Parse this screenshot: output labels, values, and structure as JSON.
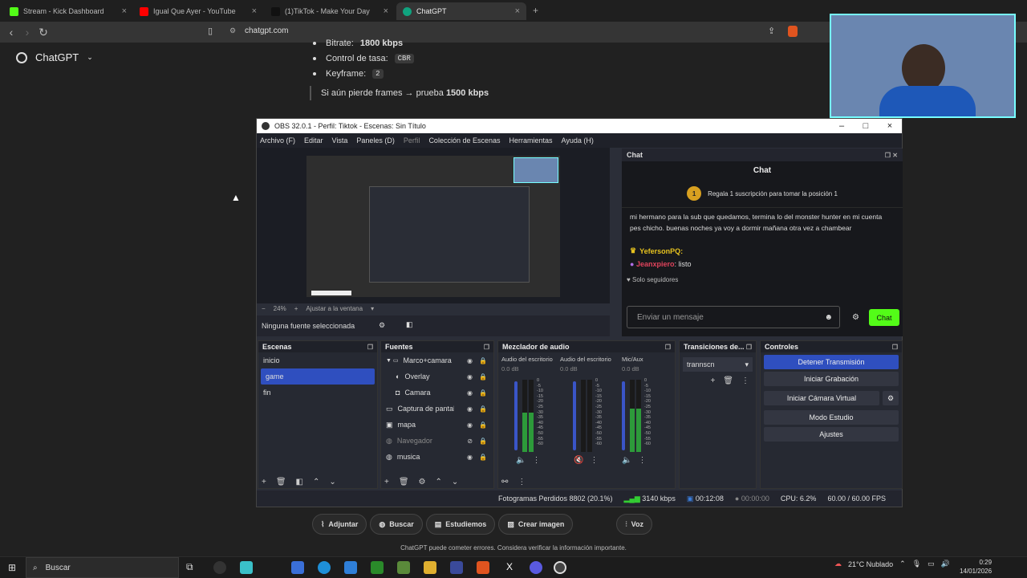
{
  "browser": {
    "tabs": [
      {
        "label": "Stream - Kick Dashboard",
        "color": "#53fc18"
      },
      {
        "label": "Igual Que Ayer - YouTube",
        "color": "#ff0000"
      },
      {
        "label": "(1)TikTok - Make Your Day",
        "color": "#111111"
      },
      {
        "label": "ChatGPT",
        "color": "#10a37f"
      }
    ],
    "url": "chatgpt.com"
  },
  "chatgpt": {
    "logo_label": "ChatGPT",
    "bullets": [
      {
        "label": "Bitrate:",
        "value": "1800 kbps"
      },
      {
        "label": "Control de tasa:",
        "value": "CBR"
      },
      {
        "label": "Keyframe:",
        "value": "2"
      }
    ],
    "quote_prefix": "Si aún pierde frames → prueba",
    "quote_value": "1500 kbps",
    "buttons": [
      "Adjuntar",
      "Buscar",
      "Estudiemos",
      "Crear imagen"
    ],
    "voice": "Voz",
    "disclaimer": "ChatGPT puede cometer errores. Considera verificar la información importante."
  },
  "obs": {
    "title": "OBS 32.0.1 - Perfil: Tiktok - Escenas: Sin Título",
    "menu": [
      "Archivo (F)",
      "Editar",
      "Vista",
      "Paneles (D)",
      "Perfil",
      "Colección de Escenas",
      "Herramientas",
      "Ayuda (H)"
    ],
    "zoom": "24%",
    "fit": "Ajustar a la ventana",
    "no_source": "Ninguna fuente seleccionada",
    "chat": {
      "dock_title": "Chat",
      "header": "Chat",
      "gift_text": "Regala 1 suscripción para tomar la posición 1",
      "msg1": "mi hermano para la sub que quedamos, termina lo del monster hunter en mi cuenta pes chicho. buenas noches ya voy a dormir mañana otra vez a chambear",
      "user2": "YefersonPQ:",
      "user3": "Jeanxpiero",
      "msg3": ": listo",
      "followers": "Solo seguidores",
      "placeholder": "Enviar un mensaje",
      "send": "Chat"
    },
    "scenes": {
      "title": "Escenas",
      "items": [
        "inicio",
        "game",
        "fin"
      ],
      "selected": 1
    },
    "sources": {
      "title": "Fuentes",
      "items": [
        "Marco+camara",
        "Overlay",
        "Camara",
        "Captura de pantalla",
        "mapa",
        "Navegador",
        "musica"
      ]
    },
    "mixer": {
      "title": "Mezclador de audio",
      "channels": [
        {
          "name": "Audio del escritorio",
          "db": "0.0 dB",
          "level": 0.55
        },
        {
          "name": "Audio del escritorio",
          "db": "0.0 dB",
          "level": 0.0
        },
        {
          "name": "Mic/Aux",
          "db": "0.0 dB",
          "level": 0.6
        }
      ],
      "scale": [
        "0",
        "-5",
        "-10",
        "-15",
        "-20",
        "-25",
        "-30",
        "-35",
        "-40",
        "-45",
        "-50",
        "-55",
        "-60"
      ]
    },
    "transitions": {
      "title": "Transiciones de...",
      "value": "trannscn"
    },
    "controls": {
      "title": "Controles",
      "buttons": [
        "Detener Transmisión",
        "Iniciar Grabación",
        "Iniciar Cámara Virtual",
        "Modo Estudio",
        "Ajustes"
      ]
    },
    "status": {
      "dropped": "Fotogramas Perdidos 8802 (20.1%)",
      "kbps": "3140 kbps",
      "live_time": "00:12:08",
      "rec_time": "00:00:00",
      "cpu": "CPU: 6.2%",
      "fps": "60.00 / 60.00 FPS"
    }
  },
  "taskbar": {
    "search": "Buscar",
    "weather": "21°C  Nublado",
    "time": "0:29",
    "date": "14/01/2026"
  }
}
